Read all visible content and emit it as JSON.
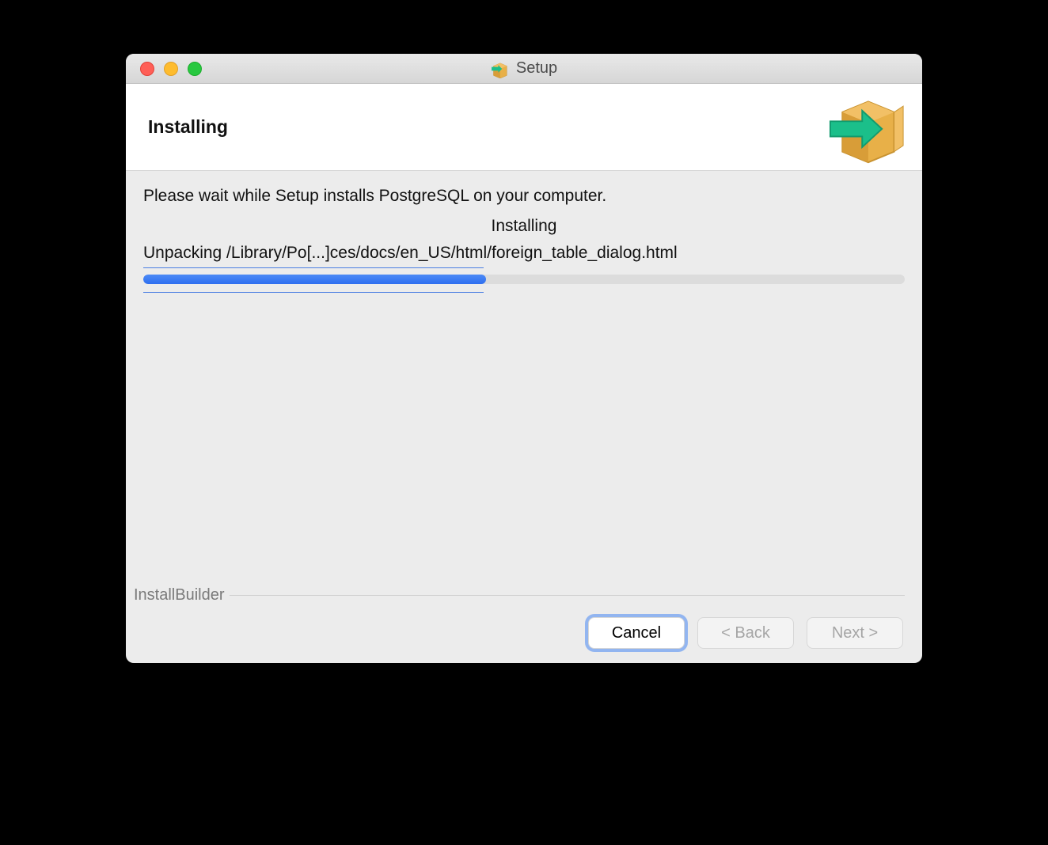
{
  "titlebar": {
    "title": "Setup"
  },
  "header": {
    "title": "Installing"
  },
  "content": {
    "instruction": "Please wait while Setup installs PostgreSQL on your computer.",
    "stage": "Installing",
    "current_file": "Unpacking /Library/Po[...]ces/docs/en_US/html/foreign_table_dialog.html",
    "progress_percent": 45
  },
  "footer": {
    "brand": "InstallBuilder",
    "cancel": "Cancel",
    "back": "< Back",
    "next": "Next >"
  },
  "colors": {
    "progress_fill": "#2e6ff0",
    "focus_ring": "#4889f4"
  }
}
